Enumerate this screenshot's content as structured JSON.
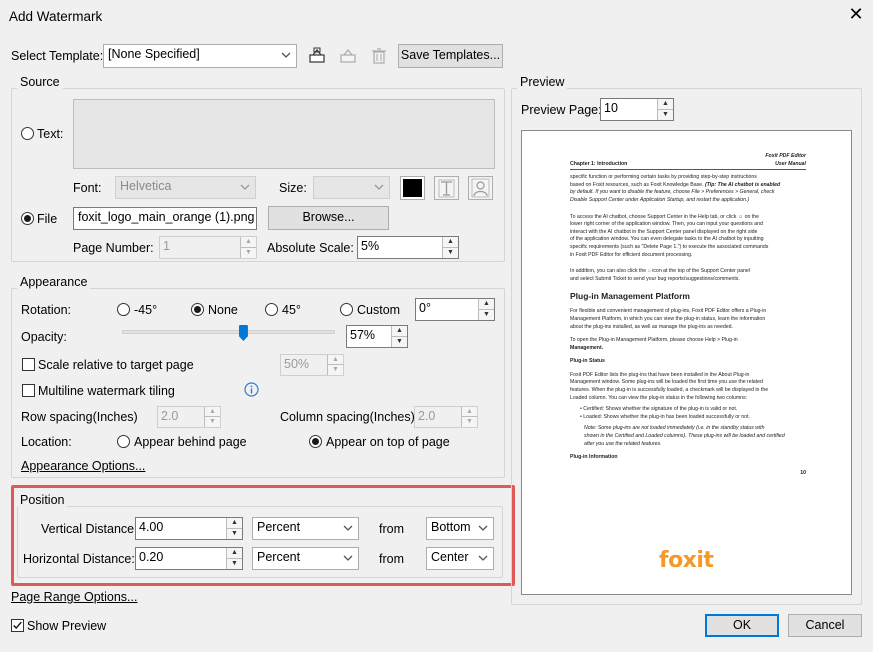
{
  "dialog": {
    "title": "Add Watermark",
    "close_icon": "close-icon"
  },
  "template": {
    "label": "Select Template:",
    "value": "[None Specified]",
    "save_label": "Save Templates..."
  },
  "source": {
    "title": "Source",
    "text_label": "Text:",
    "font_label": "Font:",
    "font_value": "Helvetica",
    "size_label": "Size:",
    "file_label": "File",
    "file_value": "foxit_logo_main_orange (1).png",
    "browse_label": "Browse...",
    "page_number_label": "Page Number:",
    "page_number_value": "1",
    "absolute_scale_label": "Absolute Scale:",
    "absolute_scale_value": "5%",
    "text_selected": false,
    "file_selected": true
  },
  "appearance": {
    "title": "Appearance",
    "rotation_label": "Rotation:",
    "rotation_options": [
      "-45°",
      "None",
      "45°",
      "Custom"
    ],
    "rotation_selected": "None",
    "rotation_custom_value": "0°",
    "opacity_label": "Opacity:",
    "opacity_value": "57%",
    "opacity_fraction": 0.57,
    "scale_label": "Scale relative to target page",
    "scale_value": "50%",
    "tiling_label": "Multiline watermark tiling",
    "row_spacing_label": "Row spacing(Inches)",
    "row_spacing_value": "2.0",
    "column_spacing_label": "Column spacing(Inches)",
    "column_spacing_value": "2.0",
    "location_label": "Location:",
    "location_behind": "Appear behind page",
    "location_top": "Appear on top of page",
    "location_selected": "top",
    "options_link": "Appearance Options..."
  },
  "position": {
    "title": "Position",
    "vertical_label": "Vertical Distance:",
    "vertical_value": "4.00",
    "vertical_unit": "Percent",
    "vertical_from_label": "from",
    "vertical_from": "Bottom",
    "horizontal_label": "Horizontal Distance:",
    "horizontal_value": "0.20",
    "horizontal_unit": "Percent",
    "horizontal_from_label": "from",
    "horizontal_from": "Center",
    "highlight_color": "#e05a5a"
  },
  "page_range_link": "Page Range Options...",
  "show_preview_label": "Show Preview",
  "show_preview_checked": true,
  "ok_label": "OK",
  "cancel_label": "Cancel",
  "preview": {
    "title": "Preview",
    "page_label": "Preview Page:",
    "page_value": "10",
    "doc": {
      "header_right_1": "Foxit PDF Editor",
      "header_right_2": "User Manual",
      "chapter": "Chapter 1: Introduction",
      "para1_a": "specific function or performing certain tasks by providing step-by-step instructions",
      "para1_b": "based on Foxit resources, such as Foxit Knowledge Base.",
      "para1_c": "(Tip: The AI chatbot is enabled",
      "para1_d": "by default. If you want to disable the feature, choose File > Preferences > General, check",
      "para1_e": "Disable Support Center under Application Startup, and restart the application.)",
      "para2_a": "To access the AI chatbot, choose Support Center in the Help tab, or click",
      "para2_b": "on the",
      "para2_c": "lower right corner of the application window. Then, you can input your questions and",
      "para2_d": "interact with the AI chatbot in the Support Center panel displayed on the right side",
      "para2_e": "of the application window. You can even delegate tasks to the AI chatbot by inputting",
      "para2_f": "specific requirements (such as \"Delete Page 1.\") to execute the associated commands",
      "para2_g": "in Foxit PDF Editor for efficient document processing.",
      "para3_a": "In addition, you can also click the",
      "para3_b": "icon at the top of the Support Center panel",
      "para3_c": "and select Submit Ticket to send your bug reports/suggestions/comments.",
      "heading": "Plug-in Management Platform",
      "para4_a": "For flexible and convenient management of plug-ins, Foxit PDF Editor offers a Plug-in",
      "para4_b": "Management Platform, in which you can view the plug-in status, learn the information",
      "para4_c": "about the plug-ins installed, as well as manage the plug-ins as needed.",
      "para5_a": "To open the Plug-in Management Platform, please choose Help > Plug-in",
      "para5_b": "Management.",
      "sub1": "Plug-in Status",
      "para6_a": "Foxit PDF Editor lists the plug-ins that have been installed in the About Plug-in",
      "para6_b": "Management window. Some plug-ins will be loaded the first time you use the related",
      "para6_c": "features. When the plug-in is successfully loaded, a checkmark will be displayed in the",
      "para6_d": "Loaded column. You can view the plug-in status in the following two columns:",
      "bullet1": "Certified: Shows whether the signature of the plug-in is valid or not.",
      "bullet2": "Loaded: Shows whether the plug-in has been loaded successfully or not.",
      "note_a": "Note: Some plug-ins are not loaded immediately (i.e. in the standby status with",
      "note_b": "shown in the Certified and Loaded columns). These plug-ins will be loaded and certified",
      "note_c": "after you use the related features.",
      "sub2": "Plug-in Information",
      "page_num": "10",
      "logo_text": "foxit",
      "logo_color": "#f39a2b"
    }
  }
}
